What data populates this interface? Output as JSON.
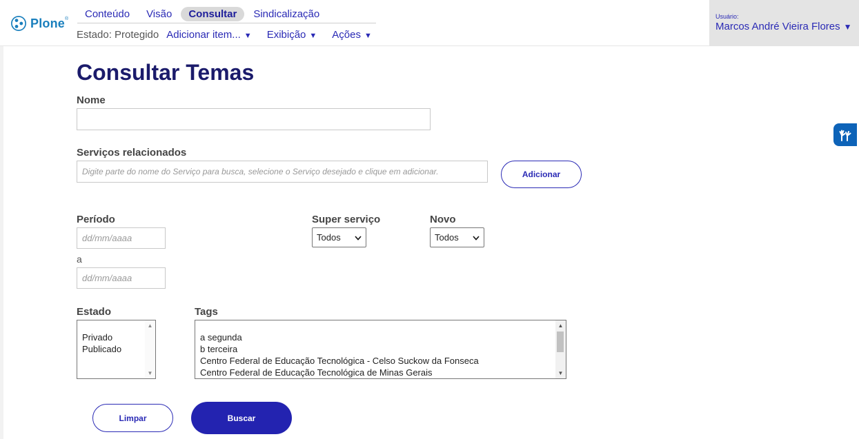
{
  "brand": {
    "name": "Plone",
    "mark": "®"
  },
  "nav": {
    "tabs": [
      {
        "label": "Conteúdo"
      },
      {
        "label": "Visão"
      },
      {
        "label": "Consultar",
        "active": true
      },
      {
        "label": "Sindicalização"
      }
    ],
    "state": "Estado: Protegido",
    "menus": [
      {
        "label": "Adicionar item..."
      },
      {
        "label": "Exibição"
      },
      {
        "label": "Ações"
      }
    ]
  },
  "user": {
    "label": "Usuário:",
    "name": "Marcos André Vieira Flores"
  },
  "page": {
    "title": "Consultar Temas"
  },
  "form": {
    "nome": {
      "label": "Nome",
      "value": ""
    },
    "servicos": {
      "label": "Serviços relacionados",
      "placeholder": "Digite parte do nome do Serviço para busca, selecione o Serviço desejado e clique em adicionar.",
      "add_label": "Adicionar"
    },
    "periodo": {
      "label": "Período",
      "from_placeholder": "dd/mm/aaaa",
      "sep": "a",
      "to_placeholder": "dd/mm/aaaa"
    },
    "super_servico": {
      "label": "Super serviço",
      "value": "Todos"
    },
    "novo": {
      "label": "Novo",
      "value": "Todos"
    },
    "estado": {
      "label": "Estado",
      "options": [
        "Privado",
        "Publicado"
      ]
    },
    "tags": {
      "label": "Tags",
      "options": [
        "a segunda",
        "b terceira",
        "Centro Federal de Educação Tecnológica - Celso Suckow da Fonseca",
        "Centro Federal de Educação Tecnológica de Minas Gerais"
      ]
    },
    "actions": {
      "clear_label": "Limpar",
      "search_label": "Buscar"
    }
  },
  "icons": {
    "logo": "plone-logo-icon",
    "accessibility": "vlibras-hands-icon",
    "caret": "▼",
    "scroll_up": "▲",
    "scroll_down": "▼"
  },
  "colors": {
    "accent": "#2a2ab5",
    "title": "#1b1b6b",
    "primary_button": "#2323b0",
    "vlibras": "#0d63b8",
    "brand": "#1a7fbd"
  }
}
